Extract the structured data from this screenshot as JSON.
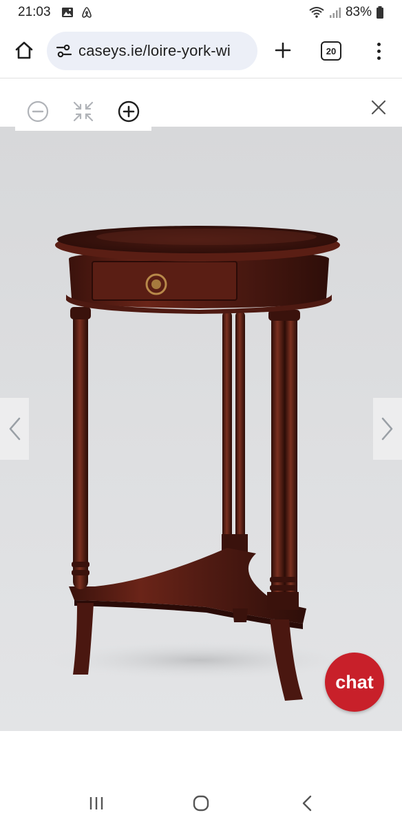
{
  "status_bar": {
    "time": "21:03",
    "battery": "83%",
    "left_icons": [
      "image-icon",
      "airbnb-icon"
    ],
    "right_icons": [
      "wifi-icon",
      "signal-icon",
      "battery-icon"
    ]
  },
  "browser": {
    "url": "caseys.ie/loire-york-wi",
    "tab_count": "20",
    "icons": [
      "home-icon",
      "site-settings-icon",
      "plus-icon",
      "tabs-icon",
      "more-vert-icon"
    ]
  },
  "viewer": {
    "controls": [
      "zoom-out-icon",
      "fit-screen-icon",
      "zoom-in-icon",
      "close-icon"
    ],
    "arrows": [
      "chevron-left-icon",
      "chevron-right-icon"
    ]
  },
  "chat": {
    "label": "chat",
    "color": "#c8202a"
  },
  "colors": {
    "url_pill": "#eceff7",
    "image_background": "#dcdddf",
    "wood": "#4a1710"
  },
  "nav": {
    "icons": [
      "recents-icon",
      "home-circle-icon",
      "back-icon"
    ]
  }
}
